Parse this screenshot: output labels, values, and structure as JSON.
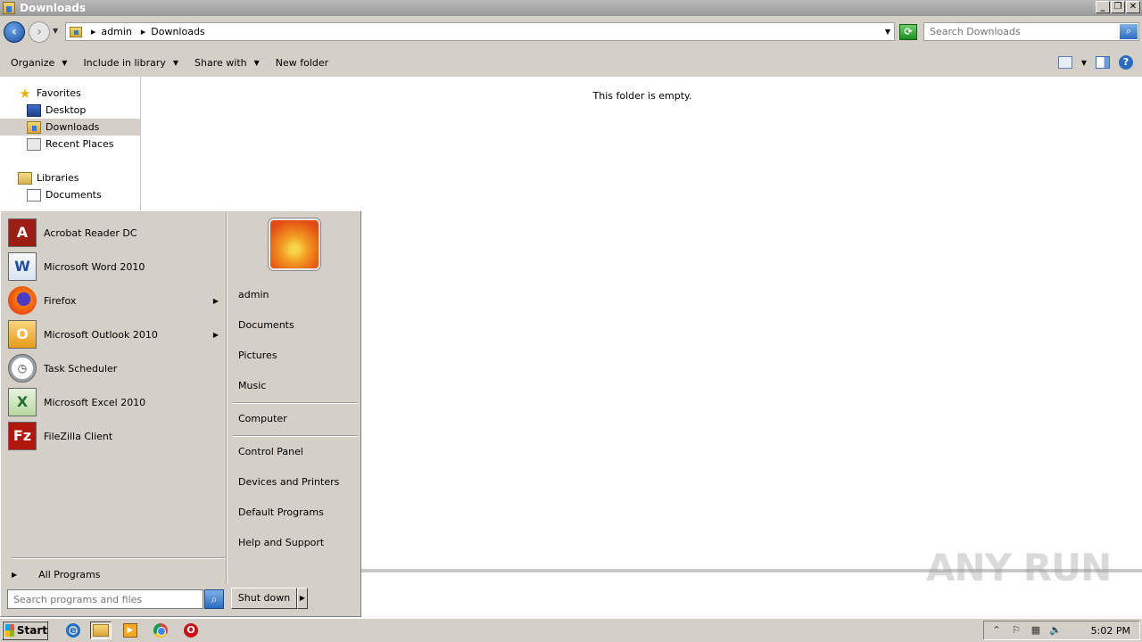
{
  "window": {
    "title": "Downloads",
    "controls": {
      "minimize": "_",
      "maximize": "❐",
      "close": "✕"
    }
  },
  "address": {
    "breadcrumbs": [
      "admin",
      "Downloads"
    ],
    "search_placeholder": "Search Downloads"
  },
  "toolbar": {
    "organize": "Organize",
    "include_in_library": "Include in library",
    "share_with": "Share with",
    "new_folder": "New folder"
  },
  "navpane": {
    "favorites": "Favorites",
    "desktop": "Desktop",
    "downloads": "Downloads",
    "recent_places": "Recent Places",
    "libraries": "Libraries",
    "documents": "Documents"
  },
  "content": {
    "empty_message": "This folder is empty."
  },
  "start_menu": {
    "programs": [
      {
        "label": "Acrobat Reader DC",
        "icon": "acrobat-icon",
        "has_submenu": false
      },
      {
        "label": "Microsoft Word 2010",
        "icon": "word-icon",
        "has_submenu": false
      },
      {
        "label": "Firefox",
        "icon": "firefox-icon",
        "has_submenu": true
      },
      {
        "label": "Microsoft Outlook 2010",
        "icon": "outlook-icon",
        "has_submenu": true
      },
      {
        "label": "Task Scheduler",
        "icon": "task-scheduler-icon",
        "has_submenu": false
      },
      {
        "label": "Microsoft Excel 2010",
        "icon": "excel-icon",
        "has_submenu": false
      },
      {
        "label": "FileZilla Client",
        "icon": "filezilla-icon",
        "has_submenu": false
      }
    ],
    "all_programs": "All Programs",
    "search_placeholder": "Search programs and files",
    "right_links": {
      "user": "admin",
      "documents": "Documents",
      "pictures": "Pictures",
      "music": "Music",
      "computer": "Computer",
      "control_panel": "Control Panel",
      "devices_printers": "Devices and Printers",
      "default_programs": "Default Programs",
      "help_support": "Help and Support"
    },
    "shutdown": "Shut down"
  },
  "taskbar": {
    "start": "Start",
    "clock": "5:02 PM"
  },
  "watermark": "ANY RUN"
}
